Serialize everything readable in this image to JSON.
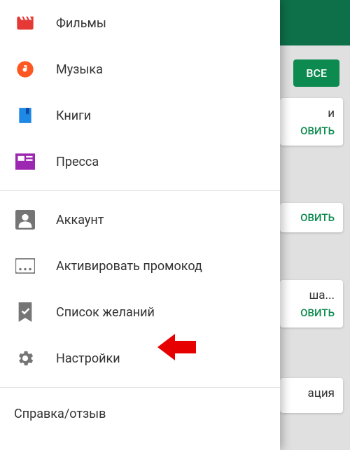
{
  "bg": {
    "all_button": "ВСЕ",
    "action": "ОВИТЬ",
    "text1": "и",
    "text2": "ша...",
    "text3": "ация"
  },
  "menu": {
    "items": [
      {
        "label": "Фильмы"
      },
      {
        "label": "Музыка"
      },
      {
        "label": "Книги"
      },
      {
        "label": "Пресса"
      },
      {
        "label": "Аккаунт"
      },
      {
        "label": "Активировать промокод"
      },
      {
        "label": "Список желаний"
      },
      {
        "label": "Настройки"
      }
    ],
    "help": "Справка/отзыв"
  },
  "colors": {
    "movies": "#e53935",
    "music": "#ff5722",
    "books": "#1e88e5",
    "news": "#9c27b0",
    "grey": "#757575"
  }
}
